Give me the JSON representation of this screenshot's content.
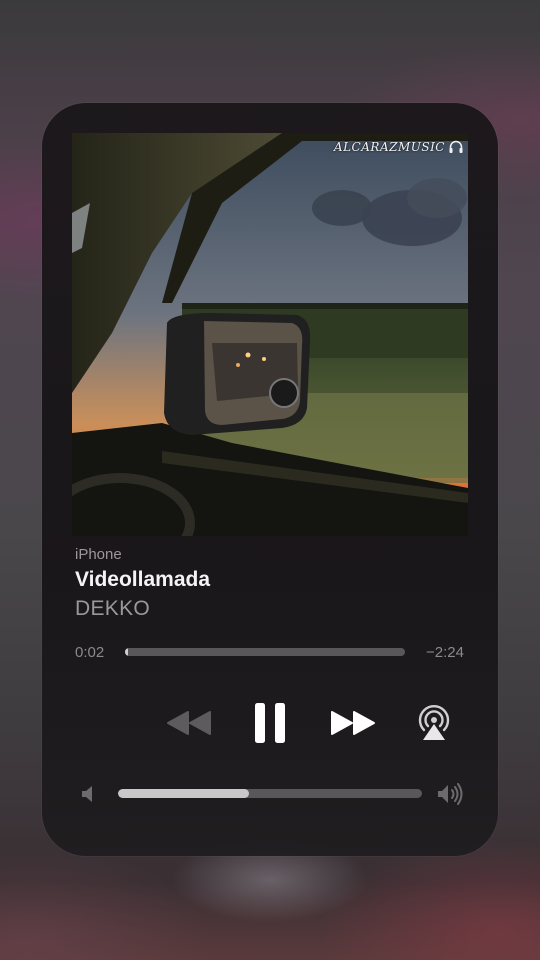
{
  "now_playing": {
    "device": "iPhone",
    "title": "Videollamada",
    "artist": "DEKKO",
    "watermark": "ALCARAZMUSIC"
  },
  "playback": {
    "elapsed": "0:02",
    "remaining": "−2:24",
    "progress_fraction": 0.01,
    "state": "playing"
  },
  "controls": {
    "previous_icon": "rewind-icon",
    "play_pause_icon": "pause-icon",
    "next_icon": "fast-forward-icon",
    "airplay_icon": "airplay-icon"
  },
  "volume": {
    "level_fraction": 0.43,
    "low_icon": "speaker-low-icon",
    "high_icon": "speaker-high-icon"
  },
  "colors": {
    "text_primary": "#f4f4f4",
    "text_secondary": "#9b979b",
    "slider_fill": "#cfcfcf",
    "slider_track": "#5a575a"
  }
}
